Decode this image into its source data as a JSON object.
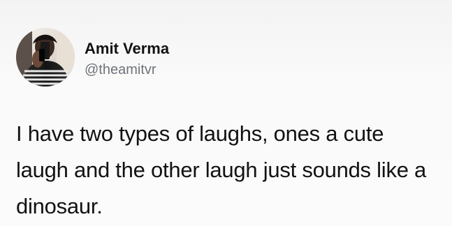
{
  "tweet": {
    "author_name": "Amit Verma",
    "author_handle": "@theamitvr",
    "avatar_icon": "profile-photo-icon",
    "text": "I have two types of laughs, ones a cute laugh and the other laugh just sounds like a dinosaur."
  },
  "colors": {
    "background": "#f7f7f7",
    "name_text": "#121212",
    "handle_text": "#6f747a",
    "body_text": "#121212"
  }
}
